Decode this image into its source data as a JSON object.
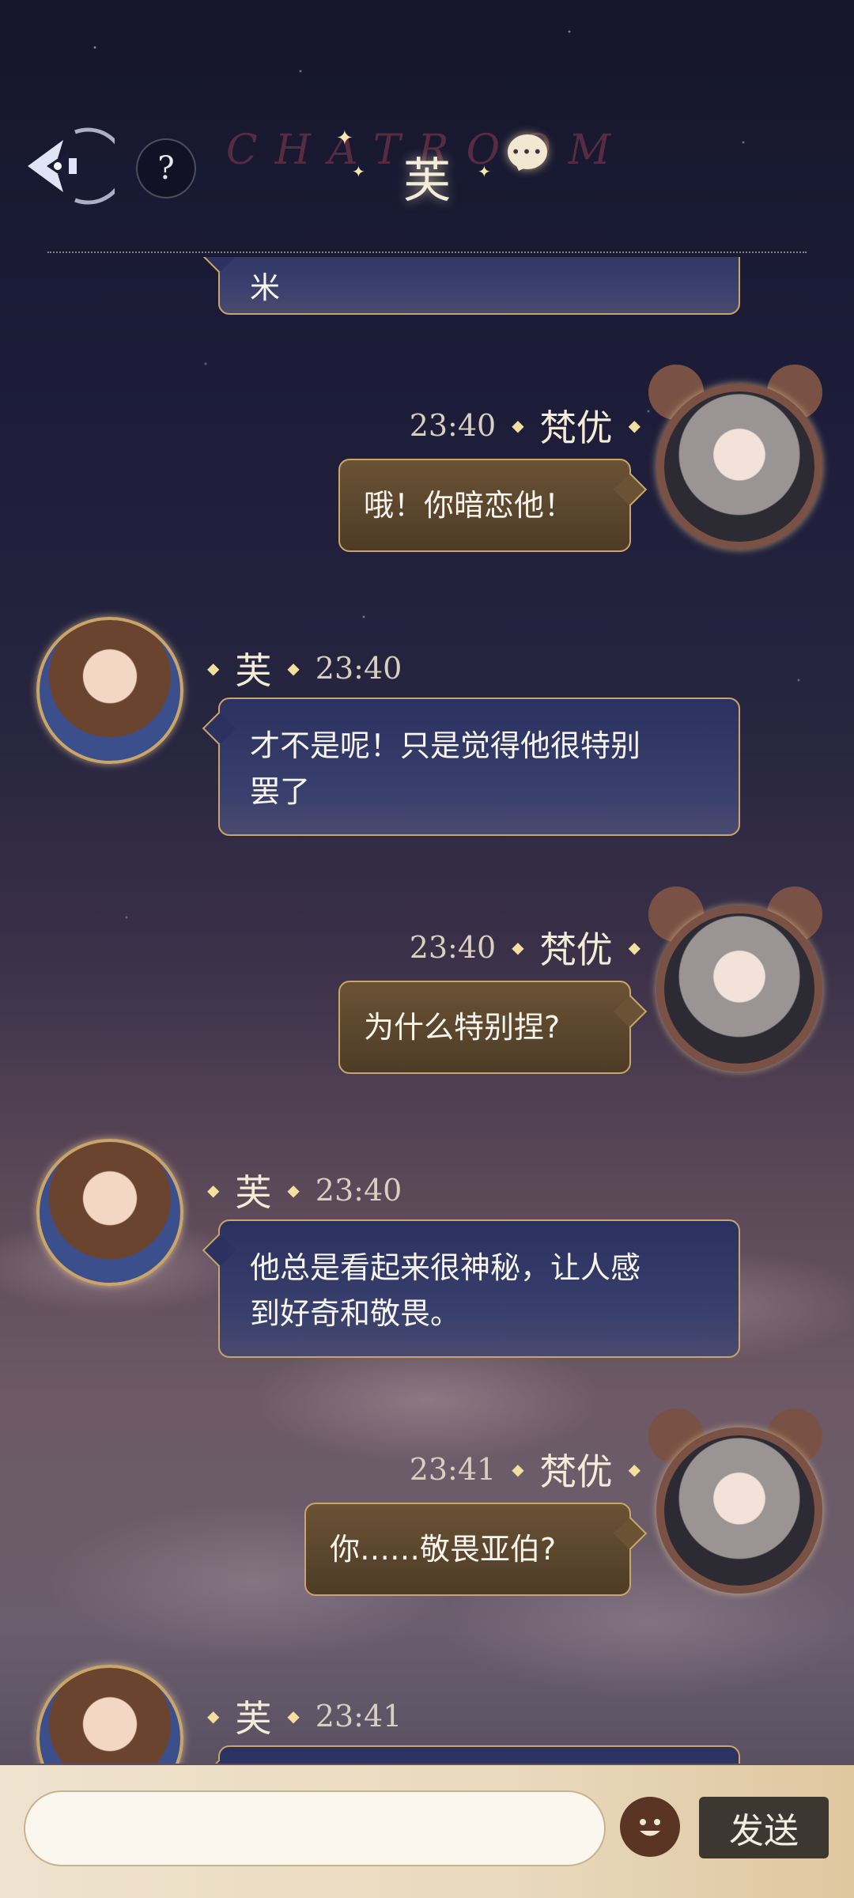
{
  "header": {
    "watermark": "CHATROOM",
    "title": "芙",
    "help_label": "?"
  },
  "partial_top_message": {
    "text": "米"
  },
  "messages": [
    {
      "sender": "梵优",
      "time": "23:40",
      "text": "哦！你暗恋他！",
      "side": "right"
    },
    {
      "sender": "芙",
      "time": "23:40",
      "lines": [
        "才不是呢！只是觉得他很特别",
        "罢了"
      ],
      "side": "left"
    },
    {
      "sender": "梵优",
      "time": "23:40",
      "text": "为什么特别捏?",
      "side": "right"
    },
    {
      "sender": "芙",
      "time": "23:40",
      "lines": [
        "他总是看起来很神秘，让人感",
        "到好奇和敬畏。"
      ],
      "side": "left"
    },
    {
      "sender": "梵优",
      "time": "23:41",
      "text": "你……敬畏亚伯?",
      "side": "right"
    },
    {
      "sender": "芙",
      "time": "23:41",
      "side": "left"
    }
  ],
  "input_bar": {
    "placeholder": "",
    "send_label": "发送"
  },
  "colors": {
    "bubble_in": "#2b3160",
    "bubble_out": "#6a5234",
    "gold_border": "#c9a56a",
    "input_bar_bg": "#efe3cf"
  }
}
